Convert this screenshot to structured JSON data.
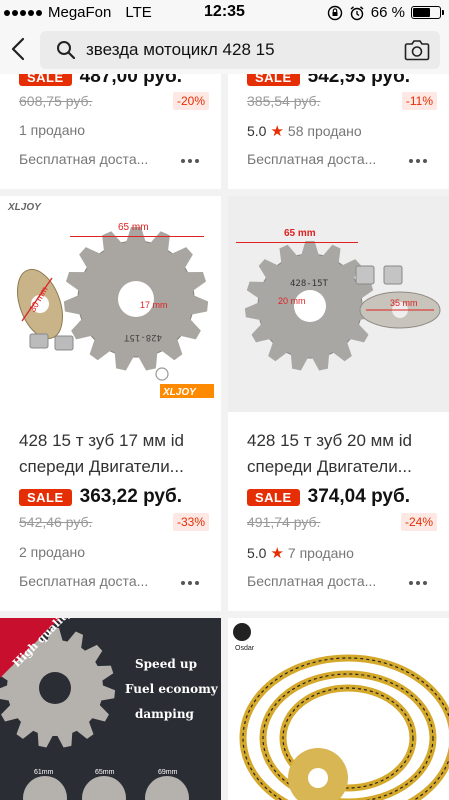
{
  "status_bar": {
    "carrier": "MegaFon",
    "network": "LTE",
    "time": "12:35",
    "battery": "66 %",
    "battery_level": 0.66
  },
  "search": {
    "query": "звезда мотоцикл 428 15"
  },
  "products": [
    {
      "sale_label": "SALE",
      "price": "487,00 руб.",
      "old_price": "608,75 руб.",
      "discount": "-20%",
      "rating": "",
      "sold": "1 продано",
      "shipping": "Бесплатная доста..."
    },
    {
      "sale_label": "SALE",
      "price": "542,93 руб.",
      "old_price": "385,54 руб.",
      "discount": "-11%",
      "rating": "5.0",
      "sold": "58 продано",
      "shipping": "Бесплатная доста..."
    },
    {
      "brand": "XLJOY",
      "img_label_1": "65 mm",
      "img_label_2": "30 mm",
      "img_label_3": "17 mm",
      "img_label_4": "428-15T",
      "title": "428 15 т зуб 17 мм id спереди Двигатели...",
      "sale_label": "SALE",
      "price": "363,22 руб.",
      "old_price": "542,46 руб.",
      "discount": "-33%",
      "rating": "",
      "sold": "2 продано",
      "shipping": "Бесплатная доста..."
    },
    {
      "img_label_1": "65 mm",
      "img_label_2": "20 mm",
      "img_label_3": "35 mm",
      "img_label_4": "428-15T",
      "title": "428 15 т зуб 20 мм id спереди Двигатели...",
      "sale_label": "SALE",
      "price": "374,04 руб.",
      "old_price": "491,74 руб.",
      "discount": "-24%",
      "rating": "5.0",
      "sold": "7 продано",
      "shipping": "Бесплатная доста..."
    },
    {
      "ribbon": "High quality",
      "features": [
        "Speed up",
        "Fuel economy",
        "damping"
      ],
      "sizes": [
        "61mm",
        "65mm",
        "69mm"
      ]
    },
    {
      "brand": "Osdar"
    }
  ],
  "colors": {
    "sale": "#e62e04",
    "discount_bg": "#fde8e4",
    "star": "#e62e04"
  }
}
